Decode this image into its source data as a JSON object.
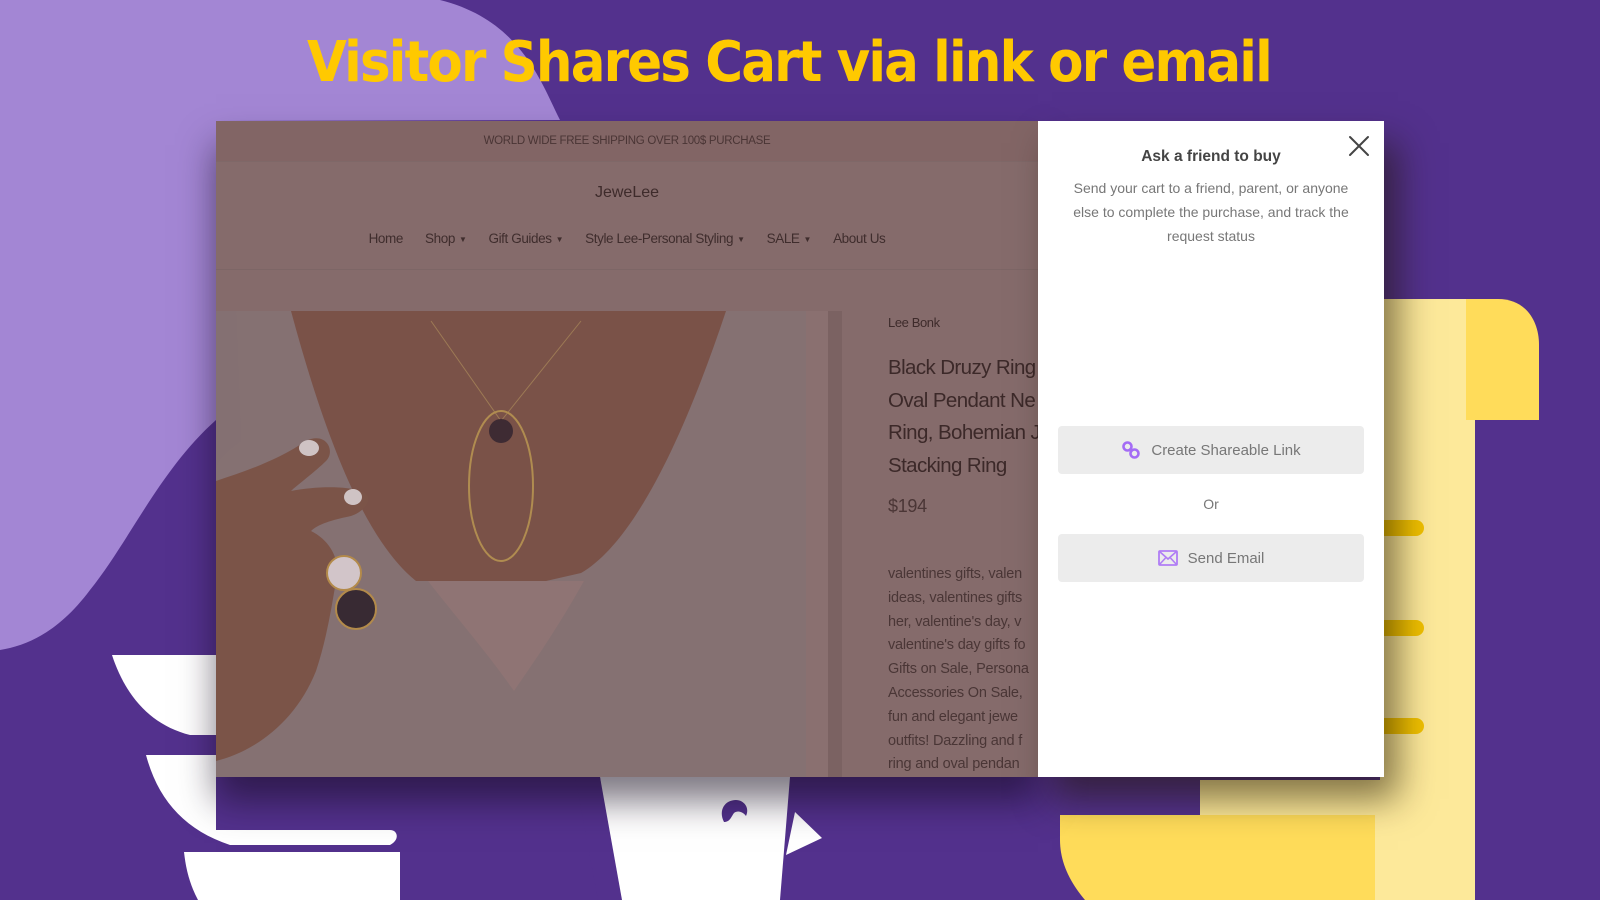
{
  "headline": "Visitor Shares Cart via link or email",
  "colors": {
    "background": "#53318d",
    "blob": "#a386d4",
    "headline": "#ffc900",
    "accent_icon": "#a46cf5",
    "scroll_yellow": "#ffdc5a",
    "scroll_light": "#fde99a"
  },
  "shop": {
    "announcement": "WORLD WIDE FREE SHIPPING OVER 100$ PURCHASE",
    "brand": "JeweLee",
    "nav": [
      {
        "label": "Home",
        "dropdown": false
      },
      {
        "label": "Shop",
        "dropdown": true
      },
      {
        "label": "Gift Guides",
        "dropdown": true
      },
      {
        "label": "Style Lee-Personal Styling",
        "dropdown": true
      },
      {
        "label": "SALE",
        "dropdown": true
      },
      {
        "label": "About Us",
        "dropdown": false
      }
    ],
    "chevron_glyph": "⌄",
    "product": {
      "vendor": "Lee Bonk",
      "title_lines": [
        "Black Druzy Ring",
        "Oval Pendant Ne",
        "Ring, Bohemian J",
        "Stacking Ring"
      ],
      "price": "$194",
      "description_lines": [
        "valentines gifts, valen",
        "ideas, valentines gifts",
        "her, valentine's day, v",
        "valentine's day gifts fo",
        "Gifts on Sale, Persona",
        "Accessories On Sale,",
        "fun and elegant jewe",
        "outfits! Dazzling and f",
        "ring and oval pendan"
      ]
    }
  },
  "modal": {
    "title": "Ask a friend to buy",
    "description": "Send your cart to a friend, parent, or anyone else to complete the purchase, and track the request status",
    "create_link_label": "Create Shareable Link",
    "or_label": "Or",
    "send_email_label": "Send Email",
    "icons": {
      "close": "close-icon",
      "link": "link-icon",
      "email": "envelope-icon"
    }
  }
}
